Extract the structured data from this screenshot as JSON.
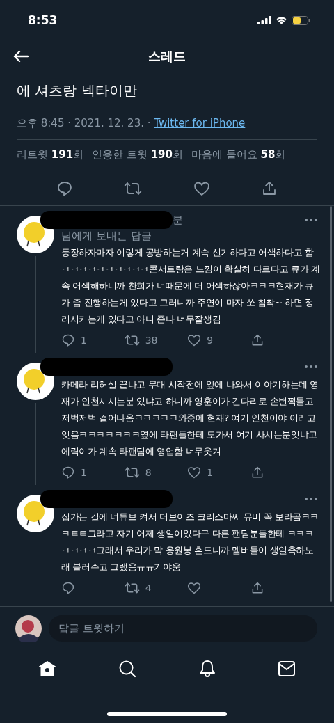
{
  "status_bar": {
    "time": "8:53"
  },
  "header": {
    "title": "스레드"
  },
  "tweet": {
    "text": "에 셔츠랑 넥타이만",
    "time": "오후 8:45 · 2021. 12. 23. · ",
    "source": "Twitter for iPhone",
    "stats": [
      "리트윗 **191**회",
      "인용한 트윗 **190**회",
      "마음에 들어요 **58**회"
    ]
  },
  "replies": [
    {
      "name_fragment": "분",
      "reply_to": "님에게 보내는 답글",
      "text": "등장하자마자 이렇게 공방하는거 계속 신기하다고 어색하다고 함 ㅋㅋㅋㅋㅋㅋㅋㅋㅋㅋ콘서트랑은 느낌이 확실히 다르다고 큐가 계속 어색해하니까 찬희가 너때문에 더 어색하잖아ㅋㅋㅋ현재가 큐가 좀 진행하는게 있다고 그러니까 주연이 마자 쏘 침착~ 하면 정리시키는게 있다고 아니 존나 너무잘생김",
      "replies": "1",
      "retweets": "38",
      "likes": "9"
    },
    {
      "text": "카메라 리허설 끝나고 무대 시작전에 앞에 나와서 이야기하는데 영재가 인천시시는분 있냐고 하니까 영훈이가 긴다리로 손번쩍들고 저벅저벅 걸어나옴ㅋㅋㅋㅋㅋ와중에 현재? 여기 인천이야 이러고잇음ㅋㅋㅋㅋㅋㅋㅋ옆에 타팬들한테 도가서 여기 사시는분잇냐고 에릭이가 계속 타팬덤에 영업함 너무웃겨",
      "replies": "1",
      "retweets": "8",
      "likes": "1"
    },
    {
      "text": "집가는 길에 너튜브 켜서 더보이즈 크리스마씨 뮤비 꼭 보라곸ㅋㅋㅋㅌㅌ그라고 자기 어제 생일이었다구 다른 팬덤분들한테 ㅋㅋㅋㅋㅋㅋㅋ그래서 우리가 막 응원봉 흔드니까 멤버들이 생일축하노래 불러주고 그랬음ㅠㅠ기야움",
      "retweets": "4"
    }
  ],
  "composer": {
    "placeholder": "답글 트윗하기"
  },
  "tab_bar": [
    {
      "kind": "home",
      "selected": true
    },
    {
      "kind": "search",
      "selected": false
    },
    {
      "kind": "bell",
      "selected": false
    },
    {
      "kind": "mail",
      "selected": false
    }
  ]
}
